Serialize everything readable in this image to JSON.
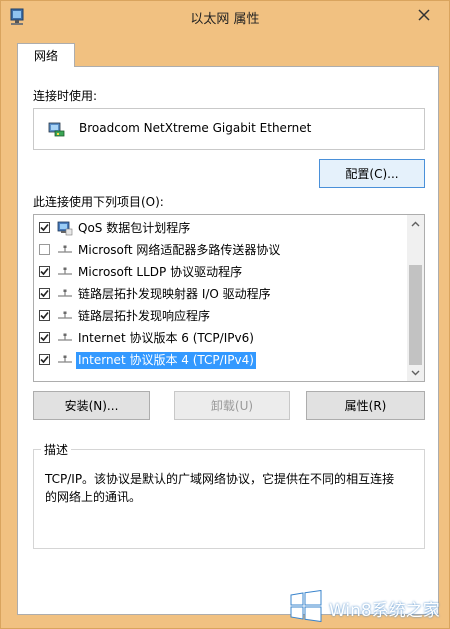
{
  "window": {
    "title": "以太网 属性"
  },
  "tabs": [
    {
      "label": "网络"
    }
  ],
  "connect_using": {
    "label": "连接时使用:",
    "adapter": "Broadcom NetXtreme Gigabit Ethernet",
    "configure_label": "配置(C)..."
  },
  "items_list": {
    "label": "此连接使用下列项目(O):",
    "items": [
      {
        "label": "QoS 数据包计划程序",
        "checked": true,
        "icon": "qos-icon"
      },
      {
        "label": "Microsoft 网络适配器多路传送器协议",
        "checked": false,
        "icon": "protocol-icon"
      },
      {
        "label": "Microsoft LLDP 协议驱动程序",
        "checked": true,
        "icon": "protocol-icon"
      },
      {
        "label": "链路层拓扑发现映射器 I/O 驱动程序",
        "checked": true,
        "icon": "protocol-icon"
      },
      {
        "label": "链路层拓扑发现响应程序",
        "checked": true,
        "icon": "protocol-icon"
      },
      {
        "label": "Internet 协议版本 6 (TCP/IPv6)",
        "checked": true,
        "icon": "protocol-icon"
      },
      {
        "label": "Internet 协议版本 4 (TCP/IPv4)",
        "checked": true,
        "icon": "protocol-icon",
        "selected": true
      }
    ]
  },
  "buttons": {
    "install": "安装(N)...",
    "uninstall": "卸载(U)",
    "properties": "属性(R)"
  },
  "description": {
    "title": "描述",
    "text": "TCP/IP。该协议是默认的广域网络协议，它提供在不同的相互连接的网络上的通讯。"
  },
  "watermark": {
    "text": "Win8系统之家"
  },
  "colors": {
    "frame": "#f1c181",
    "selection": "#3399ff",
    "accent_border": "#4a90d9"
  }
}
